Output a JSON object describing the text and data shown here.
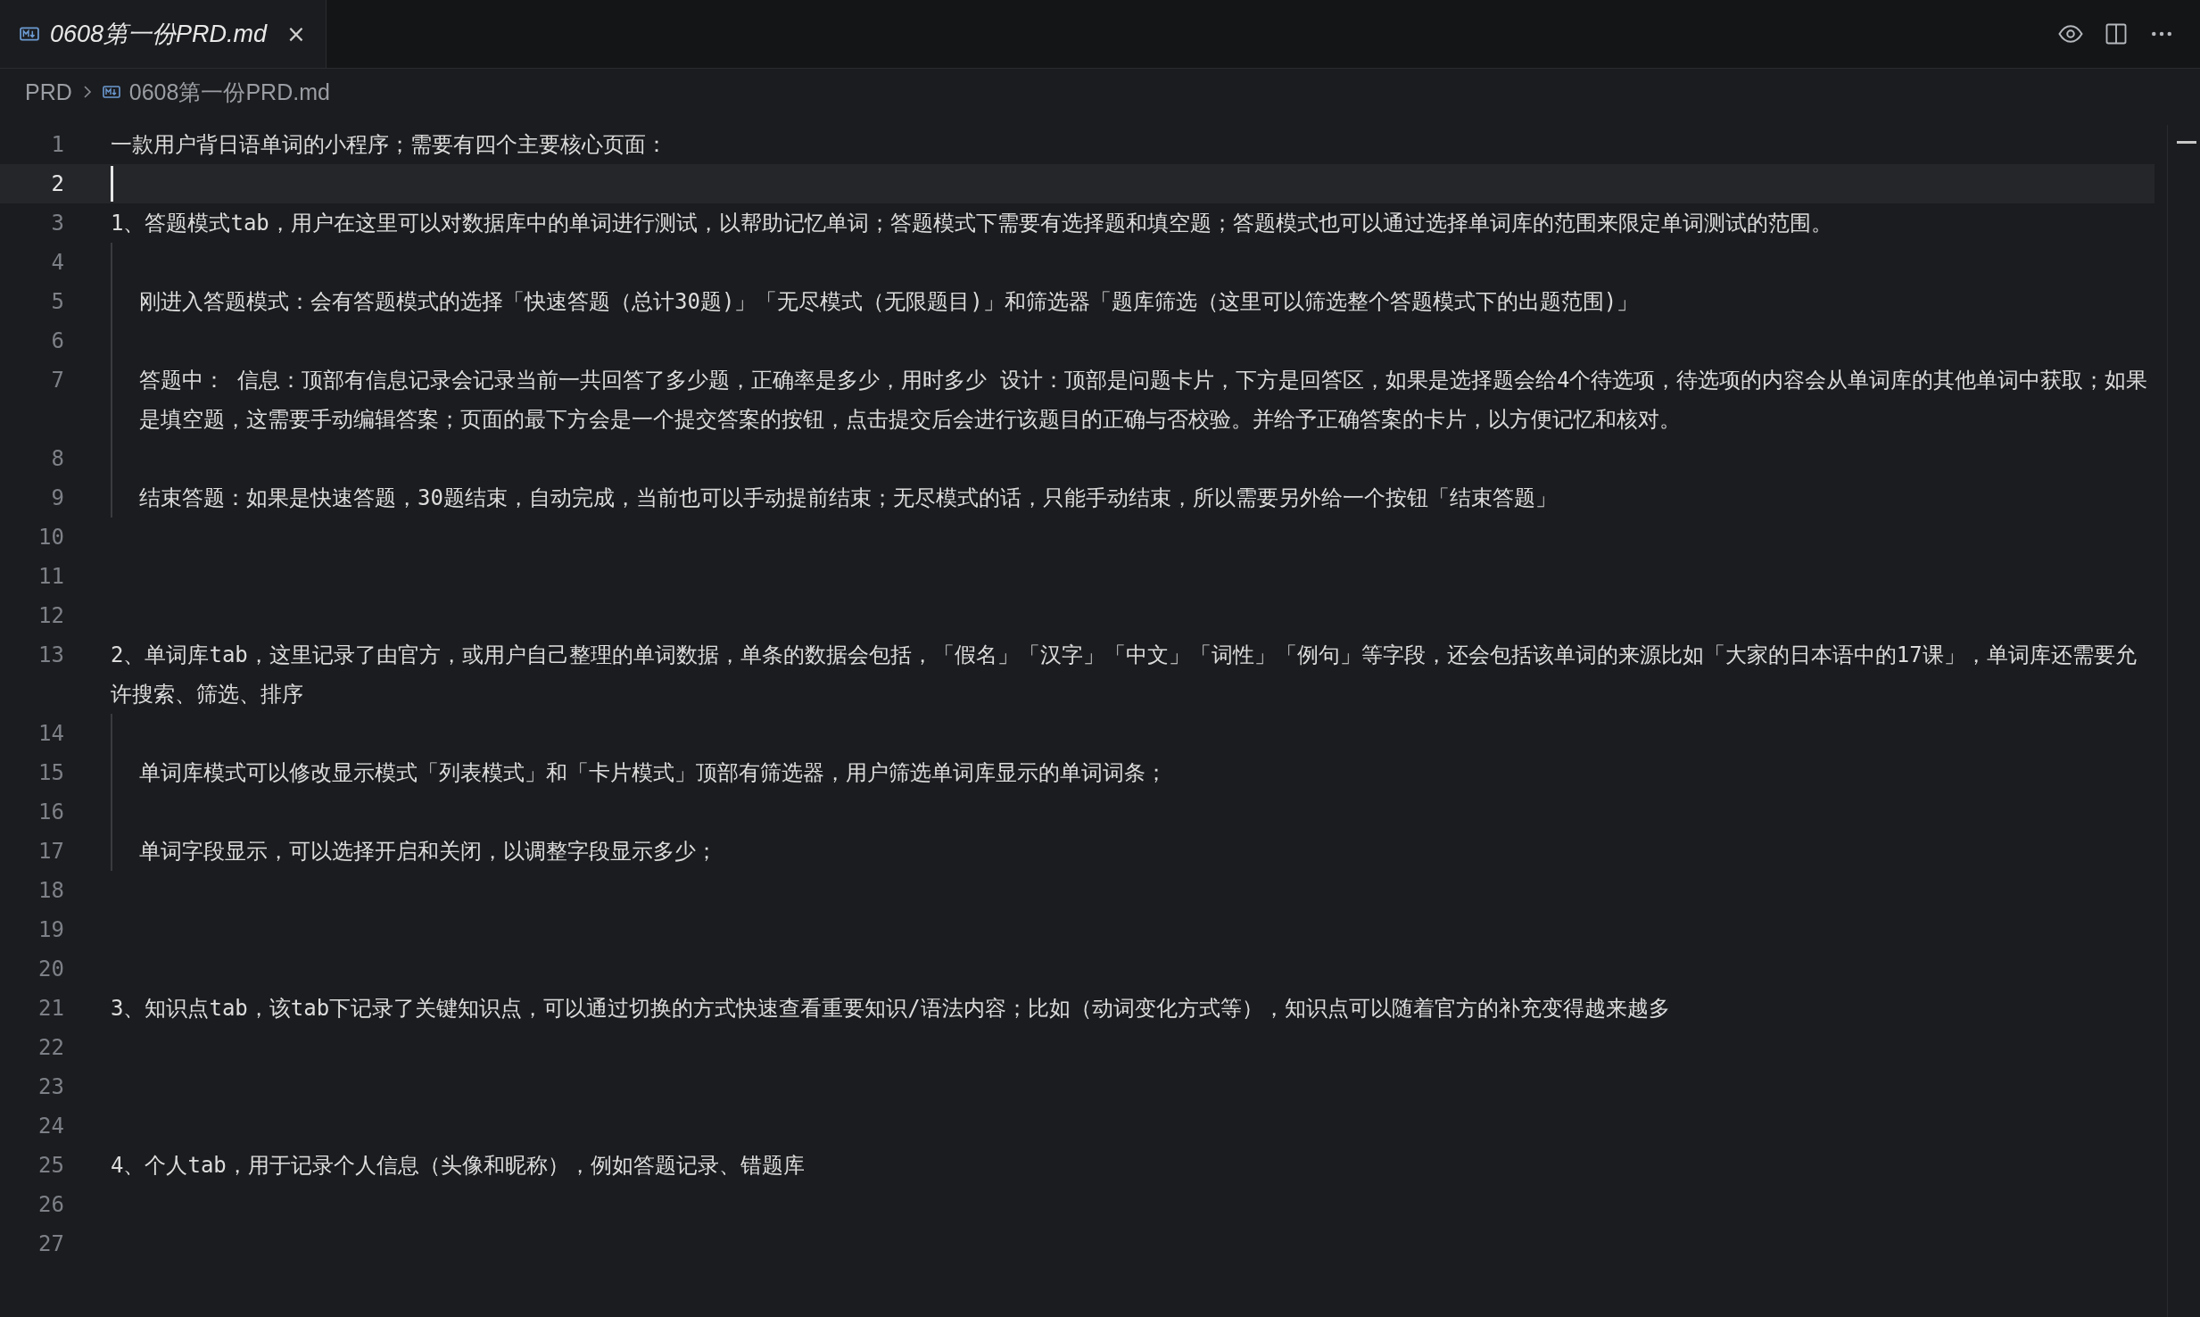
{
  "tabs": [
    {
      "label": "0608第一份PRD.md",
      "close": "×",
      "selected": true
    }
  ],
  "breadcrumb": [
    "PRD",
    "0608第一份PRD.md"
  ],
  "lines": [
    {
      "number": "1",
      "text": "一款用户背日语单词的小程序；需要有四个主要核心页面：",
      "indented": false,
      "current": false
    },
    {
      "number": "2",
      "indented": false,
      "current": true
    },
    {
      "number": "3",
      "text": "1、答题模式tab，用户在这里可以对数据库中的单词进行测试，以帮助记忆单词；答题模式下需要有选择题和填空题；答题模式也可以通过选择单词库的范围来限定单词测试的范围。",
      "indented": false,
      "current": false
    },
    {
      "number": "4",
      "indented": true,
      "current": false
    },
    {
      "number": "5",
      "text": "刚进入答题模式：会有答题模式的选择「快速答题（总计30题)」「无尽模式（无限题目)」和筛选器「题库筛选（这里可以筛选整个答题模式下的出题范围)」",
      "indented": true,
      "current": false
    },
    {
      "number": "6",
      "indented": true,
      "current": false
    },
    {
      "number": "7",
      "text": "答题中：   信息：顶部有信息记录会记录当前一共回答了多少题，正确率是多少，用时多少   设计：顶部是问题卡片，下方是回答区，如果是选择题会给4个待选项，待选项的内容会从单词库的其他单词中获取；如果是填空题，这需要手动编辑答案；页面的最下方会是一个提交答案的按钮，点击提交后会进行该题目的正确与否校验。并给予正确答案的卡片，以方便记忆和核对。",
      "indented": true,
      "current": false
    },
    {
      "number": "8",
      "indented": true,
      "current": false
    },
    {
      "number": "9",
      "text": "结束答题：如果是快速答题，30题结束，自动完成，当前也可以手动提前结束；无尽模式的话，只能手动结束，所以需要另外给一个按钮「结束答题」",
      "indented": true,
      "current": false
    },
    {
      "number": "10",
      "indented": false,
      "current": false
    },
    {
      "number": "11",
      "indented": false,
      "current": false
    },
    {
      "number": "12",
      "indented": false,
      "current": false
    },
    {
      "number": "13",
      "text": "2、单词库tab，这里记录了由官方，或用户自己整理的单词数据，单条的数据会包括，「假名」「汉字」「中文」「词性」「例句」等字段，还会包括该单词的来源比如「大家的日本语中的17课」，单词库还需要允许搜索、筛选、排序",
      "indented": false,
      "current": false
    },
    {
      "number": "14",
      "indented": true,
      "current": false
    },
    {
      "number": "15",
      "text": "单词库模式可以修改显示模式「列表模式」和「卡片模式」顶部有筛选器，用户筛选单词库显示的单词词条；",
      "indented": true,
      "current": false
    },
    {
      "number": "16",
      "indented": true,
      "current": false
    },
    {
      "number": "17",
      "text": "单词字段显示，可以选择开启和关闭，以调整字段显示多少；",
      "indented": true,
      "current": false
    },
    {
      "number": "18",
      "indented": false,
      "current": false
    },
    {
      "number": "19",
      "indented": false,
      "current": false
    },
    {
      "number": "20",
      "indented": false,
      "current": false
    },
    {
      "number": "21",
      "text": "3、知识点tab，该tab下记录了关键知识点，可以通过切换的方式快速查看重要知识/语法内容；比如（动词变化方式等），知识点可以随着官方的补充变得越来越多",
      "indented": false,
      "current": false
    },
    {
      "number": "22",
      "indented": false,
      "current": false
    },
    {
      "number": "23",
      "indented": false,
      "current": false
    },
    {
      "number": "24",
      "indented": false,
      "current": false
    },
    {
      "number": "25",
      "text": "4、个人tab，用于记录个人信息（头像和昵称），例如答题记录、错题库",
      "indented": false,
      "current": false
    },
    {
      "number": "26",
      "indented": false,
      "current": false
    },
    {
      "number": "27",
      "indented": false,
      "current": false
    }
  ]
}
